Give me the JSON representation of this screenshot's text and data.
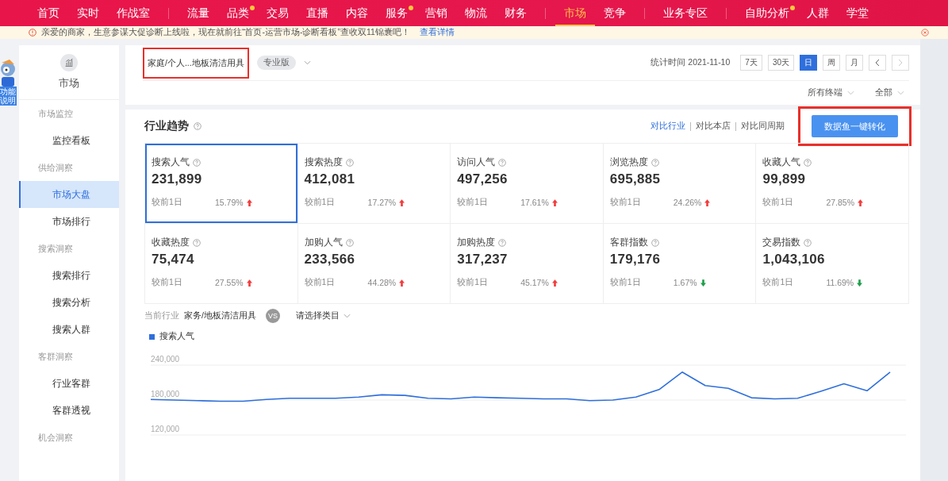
{
  "nav_groups": [
    [
      {
        "label": "首页",
        "selected": false,
        "dot": false
      },
      {
        "label": "实时",
        "selected": false,
        "dot": false
      },
      {
        "label": "作战室",
        "selected": false,
        "dot": false
      }
    ],
    [
      {
        "label": "流量",
        "selected": false,
        "dot": false
      },
      {
        "label": "品类",
        "selected": false,
        "dot": true
      },
      {
        "label": "交易",
        "selected": false,
        "dot": false
      },
      {
        "label": "直播",
        "selected": false,
        "dot": false
      },
      {
        "label": "内容",
        "selected": false,
        "dot": false
      },
      {
        "label": "服务",
        "selected": false,
        "dot": true
      },
      {
        "label": "营销",
        "selected": false,
        "dot": false
      },
      {
        "label": "物流",
        "selected": false,
        "dot": false
      },
      {
        "label": "财务",
        "selected": false,
        "dot": false
      }
    ],
    [
      {
        "label": "市场",
        "selected": true,
        "dot": false
      },
      {
        "label": "竞争",
        "selected": false,
        "dot": false
      }
    ],
    [
      {
        "label": "业务专区",
        "selected": false,
        "dot": false
      }
    ],
    [
      {
        "label": "自助分析",
        "selected": false,
        "dot": true
      },
      {
        "label": "人群",
        "selected": false,
        "dot": false
      },
      {
        "label": "学堂",
        "selected": false,
        "dot": false
      }
    ]
  ],
  "notice": {
    "text": "亲爱的商家，生意参谋大促诊断上线啦，现在就前往“首页-运营市场-诊断看板”查收双11锦囊吧！",
    "link": "查看详情"
  },
  "helper_tab": "功能说明",
  "sidebar": {
    "title": "市场",
    "items": [
      {
        "kind": "heading",
        "label": "市场监控"
      },
      {
        "kind": "item",
        "label": "监控看板",
        "selected": false
      },
      {
        "kind": "heading",
        "label": "供给洞察"
      },
      {
        "kind": "item",
        "label": "市场大盘",
        "selected": true
      },
      {
        "kind": "item",
        "label": "市场排行",
        "selected": false
      },
      {
        "kind": "heading",
        "label": "搜索洞察"
      },
      {
        "kind": "item",
        "label": "搜索排行",
        "selected": false
      },
      {
        "kind": "item",
        "label": "搜索分析",
        "selected": false
      },
      {
        "kind": "item",
        "label": "搜索人群",
        "selected": false
      },
      {
        "kind": "heading",
        "label": "客群洞察"
      },
      {
        "kind": "item",
        "label": "行业客群",
        "selected": false
      },
      {
        "kind": "item",
        "label": "客群透视",
        "selected": false
      },
      {
        "kind": "heading",
        "label": "机会洞察"
      }
    ]
  },
  "header": {
    "category": "家庭/个人...地板清洁用具",
    "category_highlighted": true,
    "edition": "专业版",
    "stat_time": "统计时间 2021-11-10",
    "periods": [
      {
        "label": "7天",
        "selected": false
      },
      {
        "label": "30天",
        "selected": false
      },
      {
        "label": "日",
        "selected": true
      },
      {
        "label": "周",
        "selected": false
      },
      {
        "label": "月",
        "selected": false
      }
    ],
    "filters": [
      "所有终端",
      "全部"
    ]
  },
  "trend": {
    "title": "行业趋势",
    "compare": [
      {
        "label": "对比行业",
        "selected": true
      },
      {
        "label": "对比本店",
        "selected": false
      },
      {
        "label": "对比同周期",
        "selected": false
      }
    ],
    "convert_button": "数据鱼一键转化",
    "convert_highlighted": true,
    "metrics": [
      {
        "name": "搜索人气",
        "value": "231,899",
        "compare": "较前1日",
        "change": "15.79%",
        "rising": true,
        "selected": true
      },
      {
        "name": "搜索热度",
        "value": "412,081",
        "compare": "较前1日",
        "change": "17.27%",
        "rising": true,
        "selected": false
      },
      {
        "name": "访问人气",
        "value": "497,256",
        "compare": "较前1日",
        "change": "17.61%",
        "rising": true,
        "selected": false
      },
      {
        "name": "浏览热度",
        "value": "695,885",
        "compare": "较前1日",
        "change": "24.26%",
        "rising": true,
        "selected": false
      },
      {
        "name": "收藏人气",
        "value": "99,899",
        "compare": "较前1日",
        "change": "27.85%",
        "rising": true,
        "selected": false
      },
      {
        "name": "收藏热度",
        "value": "75,474",
        "compare": "较前1日",
        "change": "27.55%",
        "rising": true,
        "selected": false
      },
      {
        "name": "加购人气",
        "value": "233,566",
        "compare": "较前1日",
        "change": "44.28%",
        "rising": true,
        "selected": false
      },
      {
        "name": "加购热度",
        "value": "317,237",
        "compare": "较前1日",
        "change": "45.17%",
        "rising": true,
        "selected": false
      },
      {
        "name": "客群指数",
        "value": "179,176",
        "compare": "较前1日",
        "change": "1.67%",
        "rising": false,
        "selected": false
      },
      {
        "name": "交易指数",
        "value": "1,043,106",
        "compare": "较前1日",
        "change": "11.69%",
        "rising": false,
        "selected": false
      }
    ],
    "industry_label": "当前行业",
    "industry": "家务/地板清洁用具",
    "vs": "VS",
    "category_select": "请选择类目",
    "chart_data": {
      "type": "line",
      "series": [
        {
          "name": "搜索人气",
          "color": "#2f6fdc",
          "values": [
            181000,
            180000,
            179000,
            178000,
            178000,
            181000,
            183000,
            183000,
            183000,
            185000,
            189000,
            188000,
            183000,
            182000,
            185000,
            184000,
            183000,
            182000,
            182000,
            179000,
            180000,
            185000,
            198000,
            228000,
            205000,
            200000,
            184000,
            182000,
            183000,
            195000,
            208000,
            196000,
            228000
          ]
        }
      ],
      "grid": true,
      "ylim": [
        120000,
        240000
      ],
      "yticks": [
        {
          "value": 120000,
          "label": "120,000"
        },
        {
          "value": 180000,
          "label": "180,000"
        },
        {
          "value": 240000,
          "label": "240,000"
        }
      ]
    }
  }
}
